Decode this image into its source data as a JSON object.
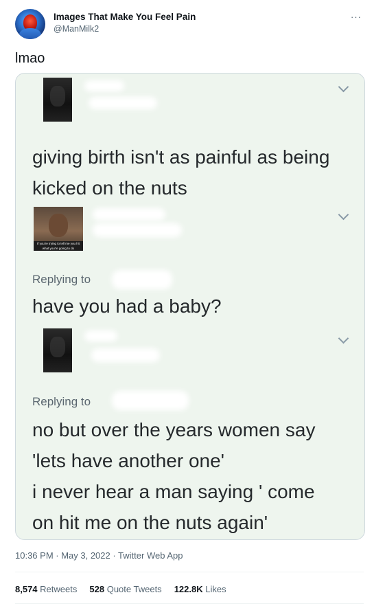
{
  "author": {
    "name": "Images That Make You Feel Pain",
    "handle": "@ManMilk2"
  },
  "more_icon": "···",
  "tweet_text": "lmao",
  "media": {
    "post_text_line1": "giving birth isn't as painful as being",
    "post_text_line2": "kicked on the nuts",
    "reply1": {
      "replying_to": "Replying to",
      "text": "have you had a baby?",
      "thumbnail_caption": "If you're trying to tell me you hit what you're going to do"
    },
    "reply2": {
      "replying_to": "Replying to",
      "line1": "no but over the years women say",
      "line2": "'lets have another one'",
      "line3": "i never hear a man saying ' come",
      "line4": "on hit me on the nuts again'"
    }
  },
  "meta": {
    "timestamp": "10:36 PM · May 3, 2022 · Twitter Web App"
  },
  "stats": {
    "retweets_count": "8,574",
    "retweets_label": "Retweets",
    "quotes_count": "528",
    "quotes_label": "Quote Tweets",
    "likes_count": "122.8K",
    "likes_label": "Likes"
  }
}
